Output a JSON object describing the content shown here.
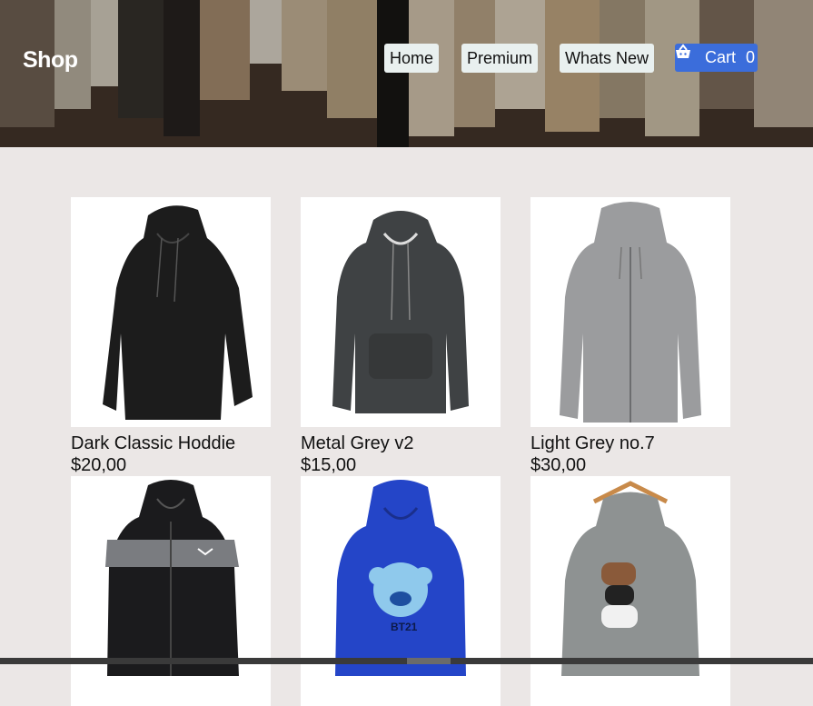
{
  "brand": {
    "name": "Shop"
  },
  "nav": {
    "items": [
      {
        "label": "Home"
      },
      {
        "label": "Premium"
      },
      {
        "label": "Whats New"
      }
    ],
    "cart": {
      "label": "Cart",
      "count": "0",
      "icon": "shopping-basket-icon",
      "color": "#3b6ddb"
    }
  },
  "products": [
    {
      "name": "Dark Classic Hoddie",
      "price": "$20,00",
      "color": "#1c1c1c"
    },
    {
      "name": "Metal Grey v2",
      "price": "$15,00",
      "color": "#3f4244"
    },
    {
      "name": "Light Grey no.7",
      "price": "$30,00",
      "color": "#9b9c9e"
    },
    {
      "name": "",
      "price": "",
      "color": "#1b1b1d"
    },
    {
      "name": "",
      "price": "",
      "color": "#2445c8"
    },
    {
      "name": "",
      "price": "",
      "color": "#8e9292"
    }
  ]
}
